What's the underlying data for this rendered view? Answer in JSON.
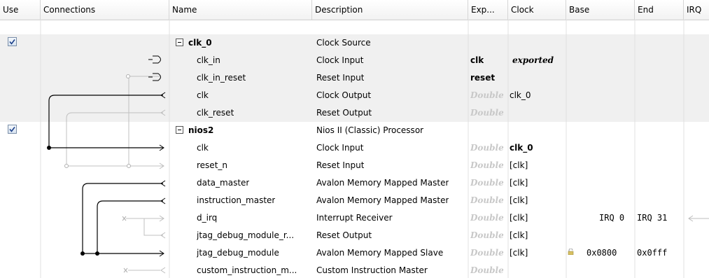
{
  "columns": {
    "use": "Use",
    "connections": "Connections",
    "name": "Name",
    "description": "Description",
    "export": "Exp...",
    "clock": "Clock",
    "base": "Base",
    "end": "End",
    "irq": "IRQ"
  },
  "rows": [
    {
      "name": "clk_0",
      "description": "Clock Source",
      "export": "",
      "clock": "",
      "base": "",
      "end": "",
      "checked": true
    },
    {
      "name": "clk_in",
      "description": "Clock Input",
      "export": "clk",
      "clock": "exported",
      "base": "",
      "end": ""
    },
    {
      "name": "clk_in_reset",
      "description": "Reset Input",
      "export": "reset",
      "clock": "",
      "base": "",
      "end": ""
    },
    {
      "name": "clk",
      "description": "Clock Output",
      "export": "Double",
      "clock": "clk_0",
      "base": "",
      "end": ""
    },
    {
      "name": "clk_reset",
      "description": "Reset Output",
      "export": "Double",
      "clock": "",
      "base": "",
      "end": ""
    },
    {
      "name": "nios2",
      "description": "Nios II (Classic) Processor",
      "export": "",
      "clock": "",
      "base": "",
      "end": "",
      "checked": true
    },
    {
      "name": "clk",
      "description": "Clock Input",
      "export": "Double",
      "clock": "clk_0",
      "base": "",
      "end": ""
    },
    {
      "name": "reset_n",
      "description": "Reset Input",
      "export": "Double",
      "clock": "[clk]",
      "base": "",
      "end": ""
    },
    {
      "name": "data_master",
      "description": "Avalon Memory Mapped Master",
      "export": "Double",
      "clock": "[clk]",
      "base": "",
      "end": ""
    },
    {
      "name": "instruction_master",
      "description": "Avalon Memory Mapped Master",
      "export": "Double",
      "clock": "[clk]",
      "base": "",
      "end": ""
    },
    {
      "name": "d_irq",
      "description": "Interrupt Receiver",
      "export": "Double",
      "clock": "[clk]",
      "base": "IRQ 0",
      "end": "IRQ 31"
    },
    {
      "name": "jtag_debug_module_r...",
      "description": "Reset Output",
      "export": "Double",
      "clock": "[clk]",
      "base": "",
      "end": ""
    },
    {
      "name": "jtag_debug_module",
      "description": "Avalon Memory Mapped Slave",
      "export": "Double",
      "clock": "[clk]",
      "base": "0x0800",
      "end": "0x0fff"
    },
    {
      "name": "custom_instruction_m...",
      "description": "Custom Instruction Master",
      "export": "Double",
      "clock": "",
      "base": "",
      "end": ""
    }
  ],
  "colors": {
    "group_row_bg": "#f0f0f0",
    "ghost_text": "#c8c8c8",
    "grid_line": "#d6d6d6"
  },
  "icons": [
    "checkbox-checked-icon",
    "collapse-minus-icon",
    "lock-icon",
    "connection-dot-icon"
  ]
}
